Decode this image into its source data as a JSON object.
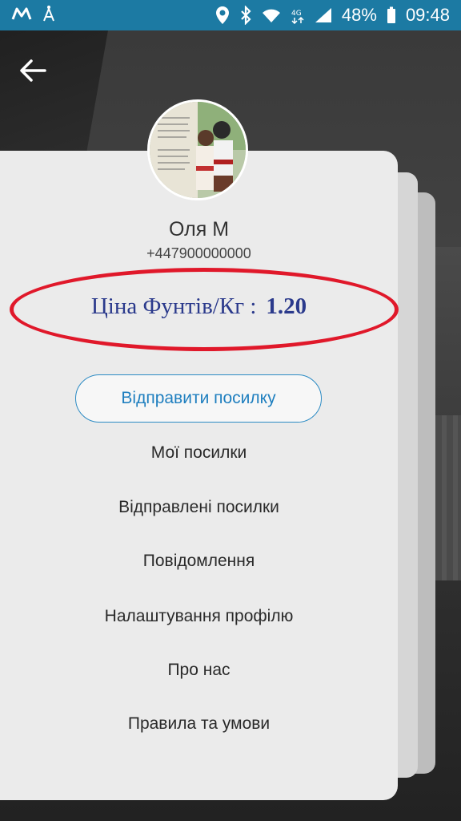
{
  "status_bar": {
    "battery": "48%",
    "time": "09:48"
  },
  "profile": {
    "name": "Оля М",
    "phone": "+447900000000"
  },
  "price": {
    "label": "Ціна Фунтів/Кг :",
    "value": "1.20"
  },
  "actions": {
    "send_label": "Відправити посилку"
  },
  "menu": {
    "items": [
      {
        "label": "Мої посилки"
      },
      {
        "label": "Відправлені посилки"
      },
      {
        "label": "Повідомлення"
      },
      {
        "label": "Налаштування профілю"
      },
      {
        "label": "Про нас"
      },
      {
        "label": "Правила та умови"
      }
    ]
  },
  "colors": {
    "status_bar": "#1c7aa3",
    "accent": "#2c8bc4",
    "price_text": "#2b3a8c",
    "highlight_ellipse": "#e0182a"
  }
}
